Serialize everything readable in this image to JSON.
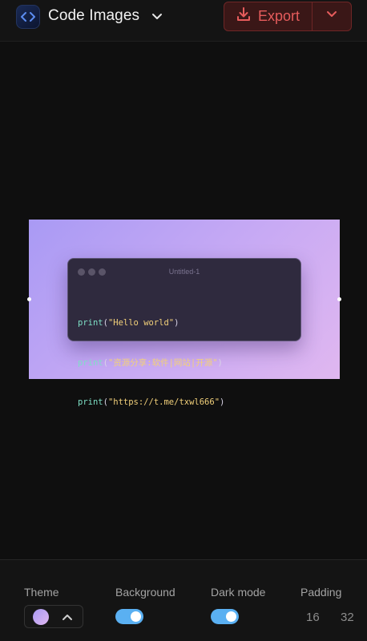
{
  "header": {
    "app_icon": "code-brackets-icon",
    "title": "Code Images",
    "export_label": "Export",
    "export_icon": "download-icon",
    "accent_color": "#e65c5c"
  },
  "editor": {
    "window_title": "Untitled-1",
    "background_gradient": [
      "#a99af4",
      "#e0b7f0"
    ],
    "code": [
      {
        "fn": "print",
        "open": "(",
        "str": "\"Hello world\"",
        "close": ")"
      },
      {
        "fn": "print",
        "open": "(",
        "str": "\"资源分享:软件|网站|开源\"",
        "close": ")"
      },
      {
        "fn": "print",
        "open": "(",
        "str": "\"https://t.me/txwl666\"",
        "close": ")"
      }
    ]
  },
  "toolbar": {
    "theme_label": "Theme",
    "background_label": "Background",
    "background_on": true,
    "dark_mode_label": "Dark mode",
    "dark_mode_on": true,
    "padding_label": "Padding",
    "padding_options": [
      "16",
      "32"
    ],
    "toggle_color": "#5ab0f2"
  }
}
